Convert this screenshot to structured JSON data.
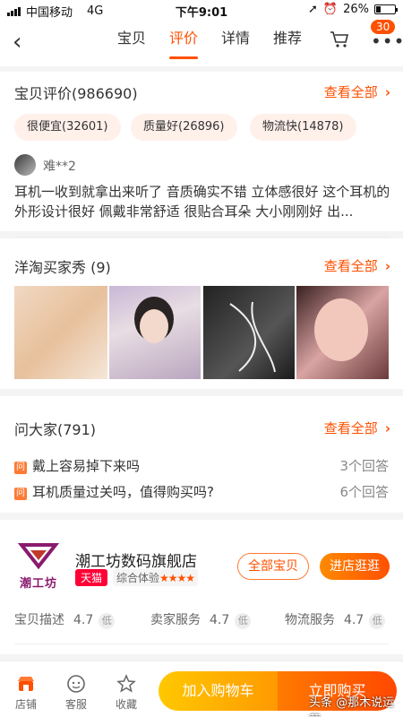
{
  "status_bar": {
    "carrier": "中国移动",
    "network": "4G",
    "time": "下午9:01",
    "battery": "26%"
  },
  "nav": {
    "tabs": [
      {
        "label": "宝贝"
      },
      {
        "label": "评价"
      },
      {
        "label": "详情"
      },
      {
        "label": "推荐"
      }
    ],
    "active_tab": "评价",
    "badge": "30",
    "more": "•••"
  },
  "reviews": {
    "title": "宝贝评价(986690)",
    "see_all": "查看全部",
    "tags": [
      "很便宜(32601)",
      "质量好(26896)",
      "物流快(14878)"
    ],
    "item": {
      "user": "难**2",
      "text": "耳机一收到就拿出来听了 音质确实不错 立体感很好 这个耳机的外形设计很好 佩戴非常舒适 很贴合耳朵 大小刚刚好 出..."
    }
  },
  "buyer_show": {
    "title": "洋淘买家秀 (9)",
    "see_all": "查看全部"
  },
  "qa": {
    "title": "问大家(791)",
    "see_all": "查看全部",
    "badge": "问",
    "items": [
      {
        "question": "戴上容易掉下来吗",
        "answers": "3个回答"
      },
      {
        "question": "耳机质量过关吗，值得购买吗?",
        "answers": "6个回答"
      }
    ]
  },
  "shop": {
    "logo_text": "潮工坊",
    "name": "潮工坊数码旗舰店",
    "tmall": "天猫",
    "experience": "综合体验",
    "stars": "★★★★",
    "all_items": "全部宝贝",
    "enter_shop": "进店逛逛",
    "metrics": [
      {
        "label": "宝贝描述",
        "value": "4.7",
        "level": "低"
      },
      {
        "label": "卖家服务",
        "value": "4.7",
        "level": "低"
      },
      {
        "label": "物流服务",
        "value": "4.7",
        "level": "低"
      }
    ]
  },
  "bottom_bar": {
    "items": [
      {
        "label": "店铺",
        "icon": "store-icon"
      },
      {
        "label": "客服",
        "icon": "service-icon"
      },
      {
        "label": "收藏",
        "icon": "star-icon"
      }
    ],
    "add_cart": "加入购物车",
    "buy_now": "立即购买"
  },
  "watermark": "头条 @那木说运营",
  "colors": {
    "accent": "#ff5000",
    "tag_bg": "#fff0ea",
    "tmall": "#ff0036"
  }
}
